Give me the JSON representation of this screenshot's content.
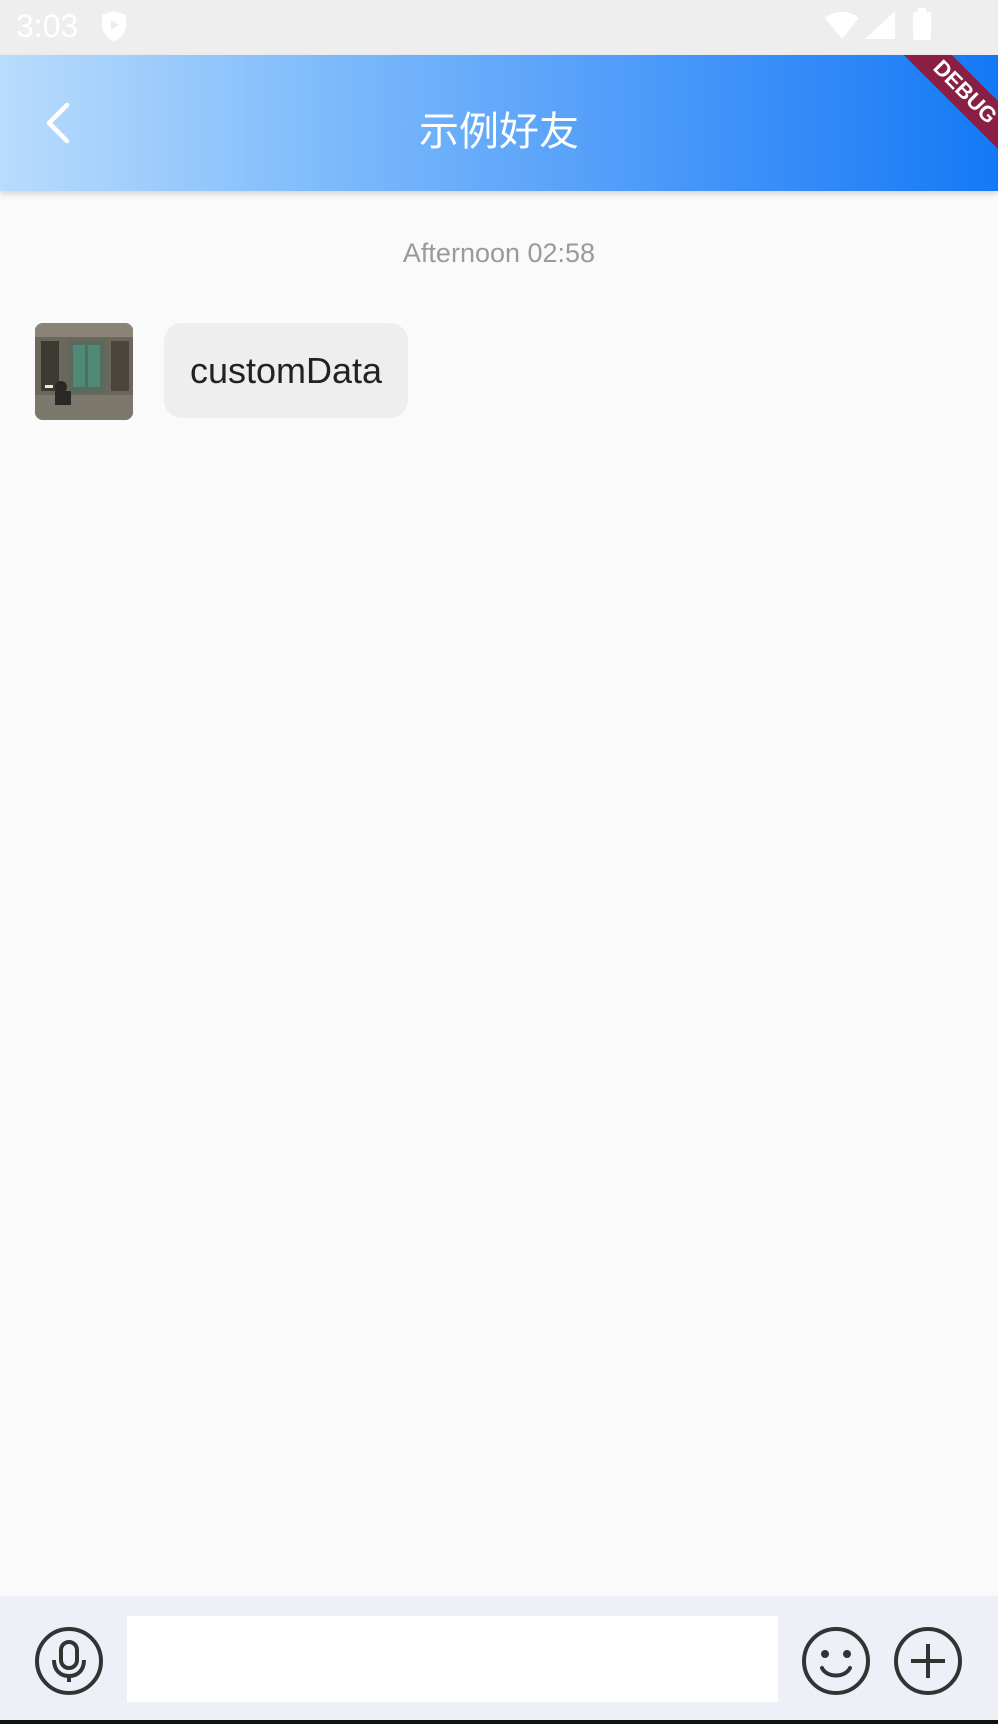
{
  "status_bar": {
    "time": "3:03",
    "icons": [
      "shield-icon",
      "wifi-icon",
      "signal-icon",
      "battery-icon"
    ]
  },
  "app_bar": {
    "title": "示例好友",
    "back_icon": "chevron-left-icon",
    "debug_banner": "DEBUG",
    "gradient": [
      "#b9dcfd",
      "#1479f5"
    ]
  },
  "chat": {
    "timestamp": "Afternoon 02:58",
    "messages": [
      {
        "sender": "friend",
        "avatar": "avatar-photo",
        "text": "customData"
      }
    ]
  },
  "input_bar": {
    "voice_icon": "microphone-icon",
    "message_value": "",
    "emoji_icon": "smiley-icon",
    "more_icon": "plus-circle-icon"
  },
  "colors": {
    "background": "#fafafa",
    "bubble": "#eeeeee",
    "input_bar": "#edf1f7",
    "icon": "#333333"
  }
}
